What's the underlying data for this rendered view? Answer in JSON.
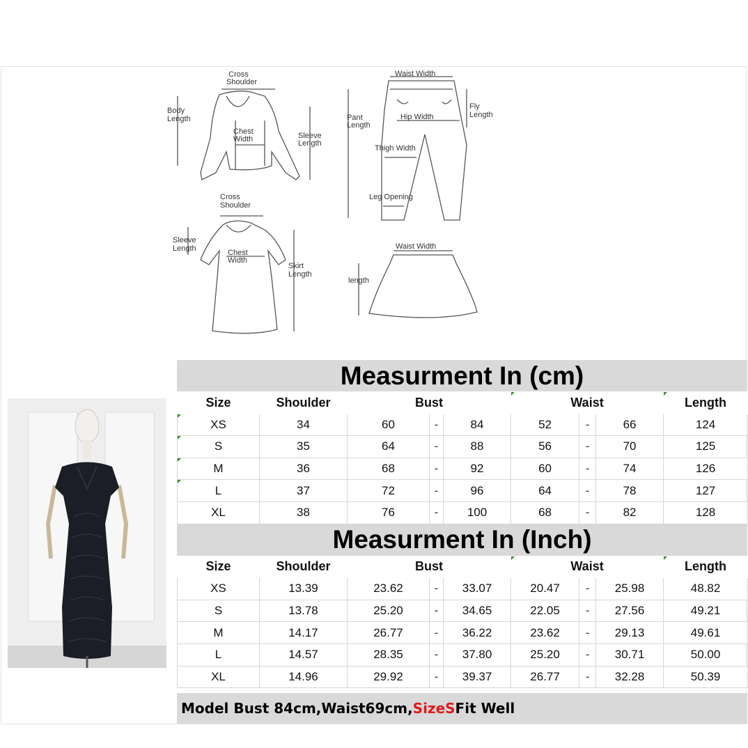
{
  "diagram": {
    "top_labels": {
      "cross_shoulder_1": "Cross Shoulder",
      "body_length": "Body Length",
      "chest_width_1": "Chest Width",
      "sleeve_length_1": "Sleeve Length",
      "waist_width_pant": "Waist Width",
      "pant_length": "Pant Length",
      "hip_width": "Hip Width",
      "fly_length": "Fly Length",
      "thigh_width": "Thigh Width",
      "leg_opening": "Leg Opening",
      "cross_shoulder_2": "Cross Shoulder",
      "sleeve_length_2": "Sleeve Length",
      "chest_width_2": "Chest Width",
      "skirt_length": "Skirt Length",
      "waist_width_skirt": "Waist Width",
      "length": "length"
    }
  },
  "cm_table": {
    "title": "Measurment In (cm)",
    "headers": [
      "Size",
      "Shoulder",
      "Bust",
      "Waist",
      "Length"
    ],
    "rows": [
      {
        "size": "XS",
        "shoulder": "34",
        "bust_min": "60",
        "bust_max": "84",
        "waist_min": "52",
        "waist_max": "66",
        "length": "124"
      },
      {
        "size": "S",
        "shoulder": "35",
        "bust_min": "64",
        "bust_max": "88",
        "waist_min": "56",
        "waist_max": "70",
        "length": "125"
      },
      {
        "size": "M",
        "shoulder": "36",
        "bust_min": "68",
        "bust_max": "92",
        "waist_min": "60",
        "waist_max": "74",
        "length": "126"
      },
      {
        "size": "L",
        "shoulder": "37",
        "bust_min": "72",
        "bust_max": "96",
        "waist_min": "64",
        "waist_max": "78",
        "length": "127"
      },
      {
        "size": "XL",
        "shoulder": "38",
        "bust_min": "76",
        "bust_max": "100",
        "waist_min": "68",
        "waist_max": "82",
        "length": "128"
      }
    ]
  },
  "inch_table": {
    "title": "Measurment In (Inch)",
    "headers": [
      "Size",
      "Shoulder",
      "Bust",
      "Waist",
      "Length"
    ],
    "rows": [
      {
        "size": "XS",
        "shoulder": "13.39",
        "bust_min": "23.62",
        "bust_max": "33.07",
        "waist_min": "20.47",
        "waist_max": "25.98",
        "length": "48.82"
      },
      {
        "size": "S",
        "shoulder": "13.78",
        "bust_min": "25.20",
        "bust_max": "34.65",
        "waist_min": "22.05",
        "waist_max": "27.56",
        "length": "49.21"
      },
      {
        "size": "M",
        "shoulder": "14.17",
        "bust_min": "26.77",
        "bust_max": "36.22",
        "waist_min": "23.62",
        "waist_max": "29.13",
        "length": "49.61"
      },
      {
        "size": "L",
        "shoulder": "14.57",
        "bust_min": "28.35",
        "bust_max": "37.80",
        "waist_min": "25.20",
        "waist_max": "30.71",
        "length": "50.00"
      },
      {
        "size": "XL",
        "shoulder": "14.96",
        "bust_min": "29.92",
        "bust_max": "39.37",
        "waist_min": "26.77",
        "waist_max": "32.28",
        "length": "50.39"
      }
    ]
  },
  "dash": "-",
  "footer": {
    "text_before": "Model Bust 84cm,Waist69cm,",
    "highlight": "SizeS",
    "text_after": " Fit Well",
    "highlight_color": "#e01b1b"
  }
}
